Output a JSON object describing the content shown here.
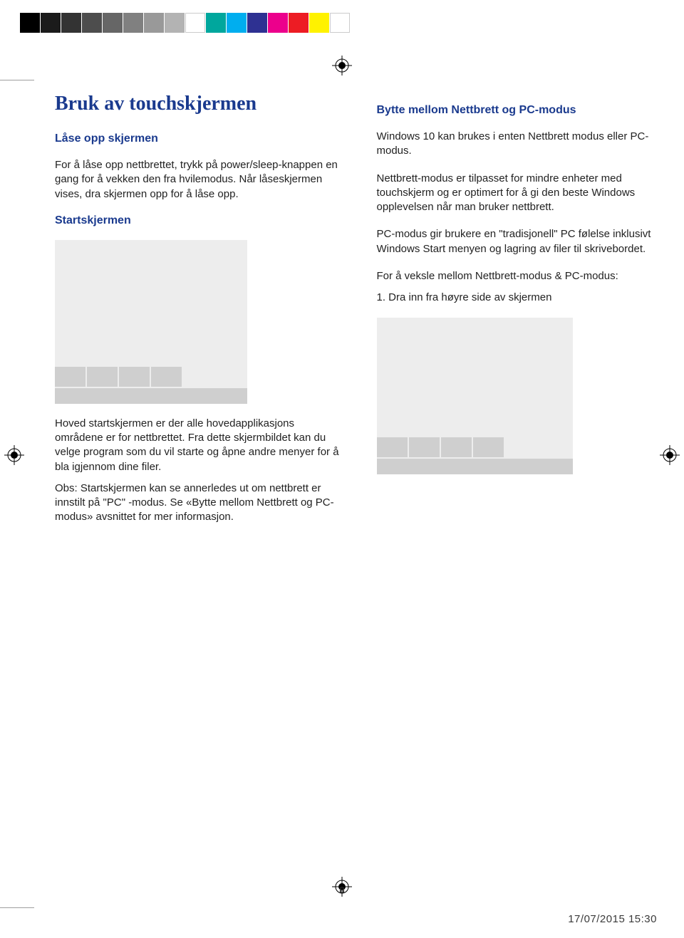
{
  "colorBar": [
    "#000000",
    "#1b1b1b",
    "#333333",
    "#4d4d4d",
    "#666666",
    "#808080",
    "#999999",
    "#b3b3b3",
    "#ffffff",
    "#00a79d",
    "#00aeef",
    "#2e3192",
    "#ec008c",
    "#ed1c24",
    "#fff200",
    "#ffffff"
  ],
  "left": {
    "title": "Bruk av touchskjermen",
    "h_lock": "Låse opp skjermen",
    "p_lock": "For å låse opp nettbrettet, trykk på power/sleep-knappen en gang for å vekken den fra hvilemodus. Når låseskjermen vises, dra skjermen opp for å låse opp.",
    "h_start": "Startskjermen",
    "p_start": "Hoved startskjermen er der alle hovedapplikasjons områdene er for nettbrettet. Fra dette skjermbildet kan du velge program som du vil starte og åpne andre menyer for å bla igjennom dine filer.",
    "p_obs": "Obs: Startskjermen kan se annerledes ut om nettbrett er innstilt på \"PC\" -modus. Se «Bytte mellom Nettbrett og PC-modus» avsnittet for mer informasjon."
  },
  "right": {
    "h_switch": "Bytte mellom Nettbrett og PC-modus",
    "p_intro": "Windows 10 kan brukes i enten Nettbrett modus eller PC-modus.",
    "p_tablet": "Nettbrett-modus er tilpasset for mindre enheter med touchskjerm og er optimert for å gi den beste Windows opplevelsen når man bruker nettbrett.",
    "p_pc": "PC-modus gir brukere en \"tradisjonell\" PC følelse inklusivt Windows Start menyen og lagring av filer til skrivebordet.",
    "p_toggle": "For å veksle mellom Nettbrett-modus & PC-modus:",
    "p_step1": "1. Dra inn fra høyre side av skjermen"
  },
  "pageNumber": "8",
  "footerTimestamp": "17/07/2015   15:30"
}
